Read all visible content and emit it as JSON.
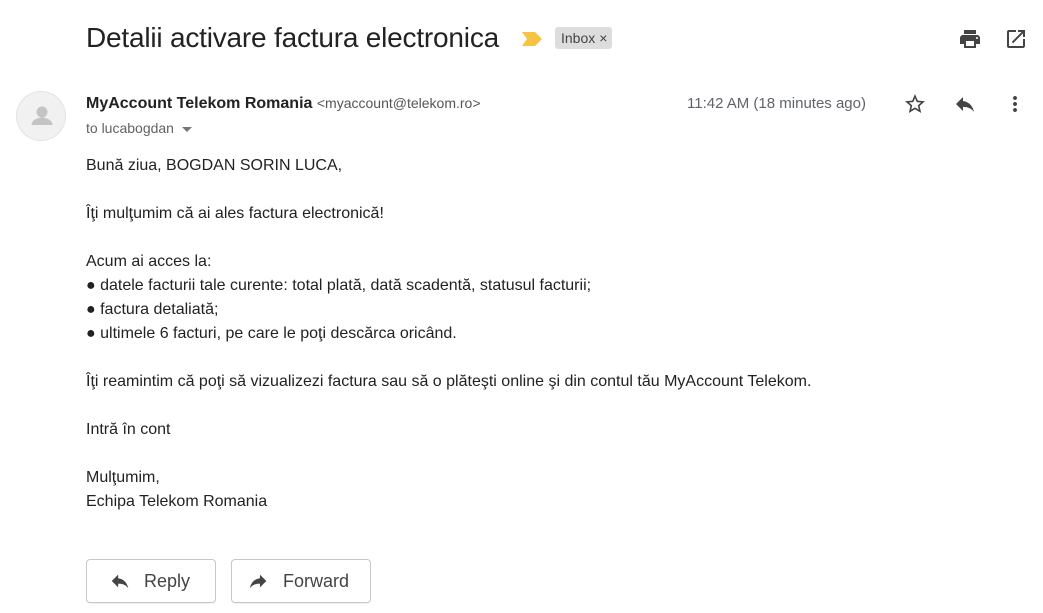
{
  "subject": "Detalii activare factura electronica",
  "label": {
    "name": "Inbox",
    "remove": "×"
  },
  "toolbar": {
    "print_icon": "print-icon",
    "popout_icon": "open-in-new-window-icon"
  },
  "message": {
    "sender_name": "MyAccount Telekom Romania",
    "sender_email": "<myaccount@telekom.ro>",
    "to": "to lucabogdan",
    "timestamp": "11:42 AM (18 minutes ago)",
    "icons": [
      "star-icon",
      "reply-icon",
      "more-vert-icon"
    ]
  },
  "body": {
    "greeting": "Bună ziua, BOGDAN SORIN LUCA,",
    "thanks": "Îţi mulţumim că ai ales factura electronică!",
    "access_intro": "Acum ai acces la:",
    "bullets": [
      "● datele facturii tale curente: total plată, dată scadentă, statusul facturii;",
      "● factura detaliată;",
      "● ultimele 6 facturi, pe care le poţi descărca oricând."
    ],
    "reminder": "Îţi reamintim că poţi să vizualizezi factura sau să o plăteşti online şi din contul tău MyAccount Telekom.",
    "link": "Intră în cont",
    "closing": "Mulţumim,",
    "signature": "Echipa Telekom Romania"
  },
  "actions": {
    "reply": "Reply",
    "forward": "Forward"
  },
  "colors": {
    "importance": "#f6c342",
    "icon": "#5f6368"
  }
}
